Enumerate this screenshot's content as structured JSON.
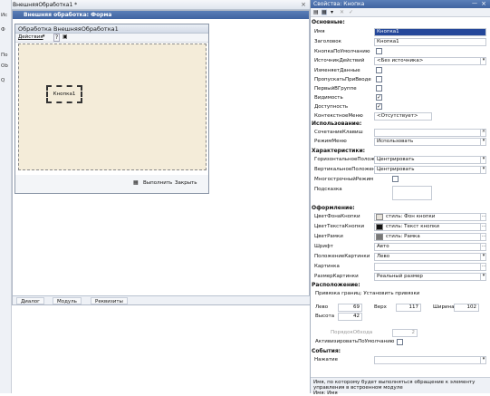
{
  "top_tab": {
    "title": "ВнешняяОбработка1 *"
  },
  "left_strip": {
    "labels": [
      "Ис",
      "Ф",
      "По",
      "Ob",
      "Q"
    ]
  },
  "designer": {
    "title": "Внешняя обработка: Форма",
    "form": {
      "title": "Обработка  ВнешняяОбработка1",
      "actions_label": "Действия",
      "help": "?",
      "button_caption": "Кнопка1",
      "run_label": "Выполнить",
      "close_label": "Закрыть"
    },
    "tabs": [
      "Диалог",
      "Модуль",
      "Реквизиты"
    ]
  },
  "props": {
    "title": "Свойства: Кнопка",
    "sections": {
      "basic": "Основные:",
      "usage": "Использование:",
      "chars": "Характеристики:",
      "design": "Оформление:",
      "layout": "Расположение:",
      "events": "События:"
    },
    "basic": {
      "name_label": "Имя",
      "name_value": "Кнопка1",
      "caption_label": "Заголовок",
      "caption_value": "Кнопка1",
      "default_label": "КнопкаПоУмолчанию",
      "action_source_label": "ИсточникДействий",
      "action_source_value": "<Без источника>",
      "change_data_label": "ИзменяетДанные",
      "skip_input_label": "ПропускатьПриВводе",
      "first_in_group_label": "ПервыйВГруппе",
      "visibility_label": "Видимость",
      "availability_label": "Доступность",
      "context_menu_label": "КонтекстноеМеню",
      "context_menu_value": "<Отсутствует>"
    },
    "usage": {
      "hotkey_label": "СочетаниеКлавиш",
      "mode_label": "РежимМеню",
      "mode_value": "Использовать"
    },
    "chars": {
      "h_label": "ГоризонтальноеПоложение",
      "h_value": "Центрировать",
      "v_label": "ВертикальноеПоложение",
      "v_value": "Центрировать",
      "multiline_label": "МногострочныйРежим",
      "hint_label": "Подсказка"
    },
    "design": {
      "bg_label": "ЦветФонаКнопки",
      "bg_value": "стиль: Фон кнопки",
      "text_label": "ЦветТекстаКнопки",
      "text_value": "стиль: Текст кнопки",
      "border_label": "ЦветРамки",
      "border_value": "стиль: Рамка",
      "font_label": "Шрифт",
      "font_value": "Авто",
      "pic_pos_label": "ПоложениеКартинки",
      "pic_pos_value": "Лево",
      "pic_label": "Картинка",
      "pic_size_label": "РазмерКартинки",
      "pic_size_value": "Реальный размер"
    },
    "layout": {
      "bind_text": "Привязка границ: Установить привязки",
      "left_label": "Лево",
      "left": "69",
      "top_label": "Верх",
      "top": "117",
      "width_label": "Ширина",
      "width": "102",
      "height_label": "Высота",
      "height": "42",
      "tab_order_label": "ПорядокОбхода",
      "tab_order": "2",
      "activate_label": "АктивизироватьПоУмолчанию"
    },
    "events": {
      "press_label": "Нажатие"
    },
    "footer": "Имя, по которому будет выполняться обращение к элементу управления в встроенном модуле\nИмя: Имя"
  }
}
